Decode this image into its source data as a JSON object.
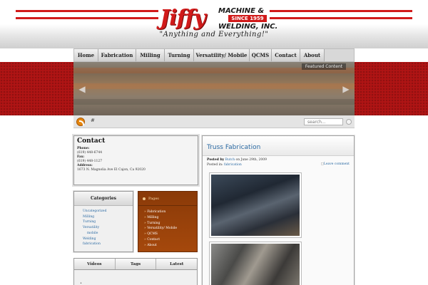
{
  "header": {
    "logo_word": "Jiffy",
    "logo_line1": "MACHINE &",
    "logo_since": "SINCE 1959",
    "logo_line2": "WELDING, INC.",
    "tagline": "\"Anything and Everything!\""
  },
  "nav": {
    "items": [
      "Home",
      "Fabrication",
      "Milling",
      "Turning",
      "Versatility/ Mobile",
      "QCMS",
      "Contact",
      "About"
    ]
  },
  "banner": {
    "caption": "Featured Content",
    "prev_icon": "chevron-left-icon",
    "next_icon": "chevron-right-icon"
  },
  "subbar": {
    "hash": "#",
    "search_placeholder": "search..."
  },
  "contact": {
    "title": "Contact",
    "phone_label": "Phone:",
    "phone": "(619) 448-6744",
    "fax_label": "Fax:",
    "fax": "(619) 448-1127",
    "address_label": "Address:",
    "address": "1673 N. Magnolia Ave El Cajon, Ca 92020"
  },
  "categories": {
    "title": "Categories",
    "items": [
      "Uncategorized",
      "Milling",
      "Turning",
      "Versatility",
      "mobile",
      "Welding",
      "fabrication"
    ]
  },
  "pages": {
    "title": "Pages",
    "items": [
      "Fabrication",
      "Milling",
      "Turning",
      "Versatility/ Mobile",
      "QCMS",
      "Contact",
      "About"
    ]
  },
  "tabs": {
    "items": [
      "Videos",
      "Tags",
      "Latest"
    ],
    "bullet": "•"
  },
  "post": {
    "title": "Truss Fabrication",
    "posted_by_label": "Posted by",
    "author": "Butch",
    "date_text": "on June 29th, 2009",
    "posted_in_label": "Posted in:",
    "category": "fabrication",
    "comment_link": "Leave comment"
  },
  "colors": {
    "brand_red": "#d11a1a",
    "link_blue": "#2b6aa3",
    "pages_brown": "#a5480c"
  }
}
